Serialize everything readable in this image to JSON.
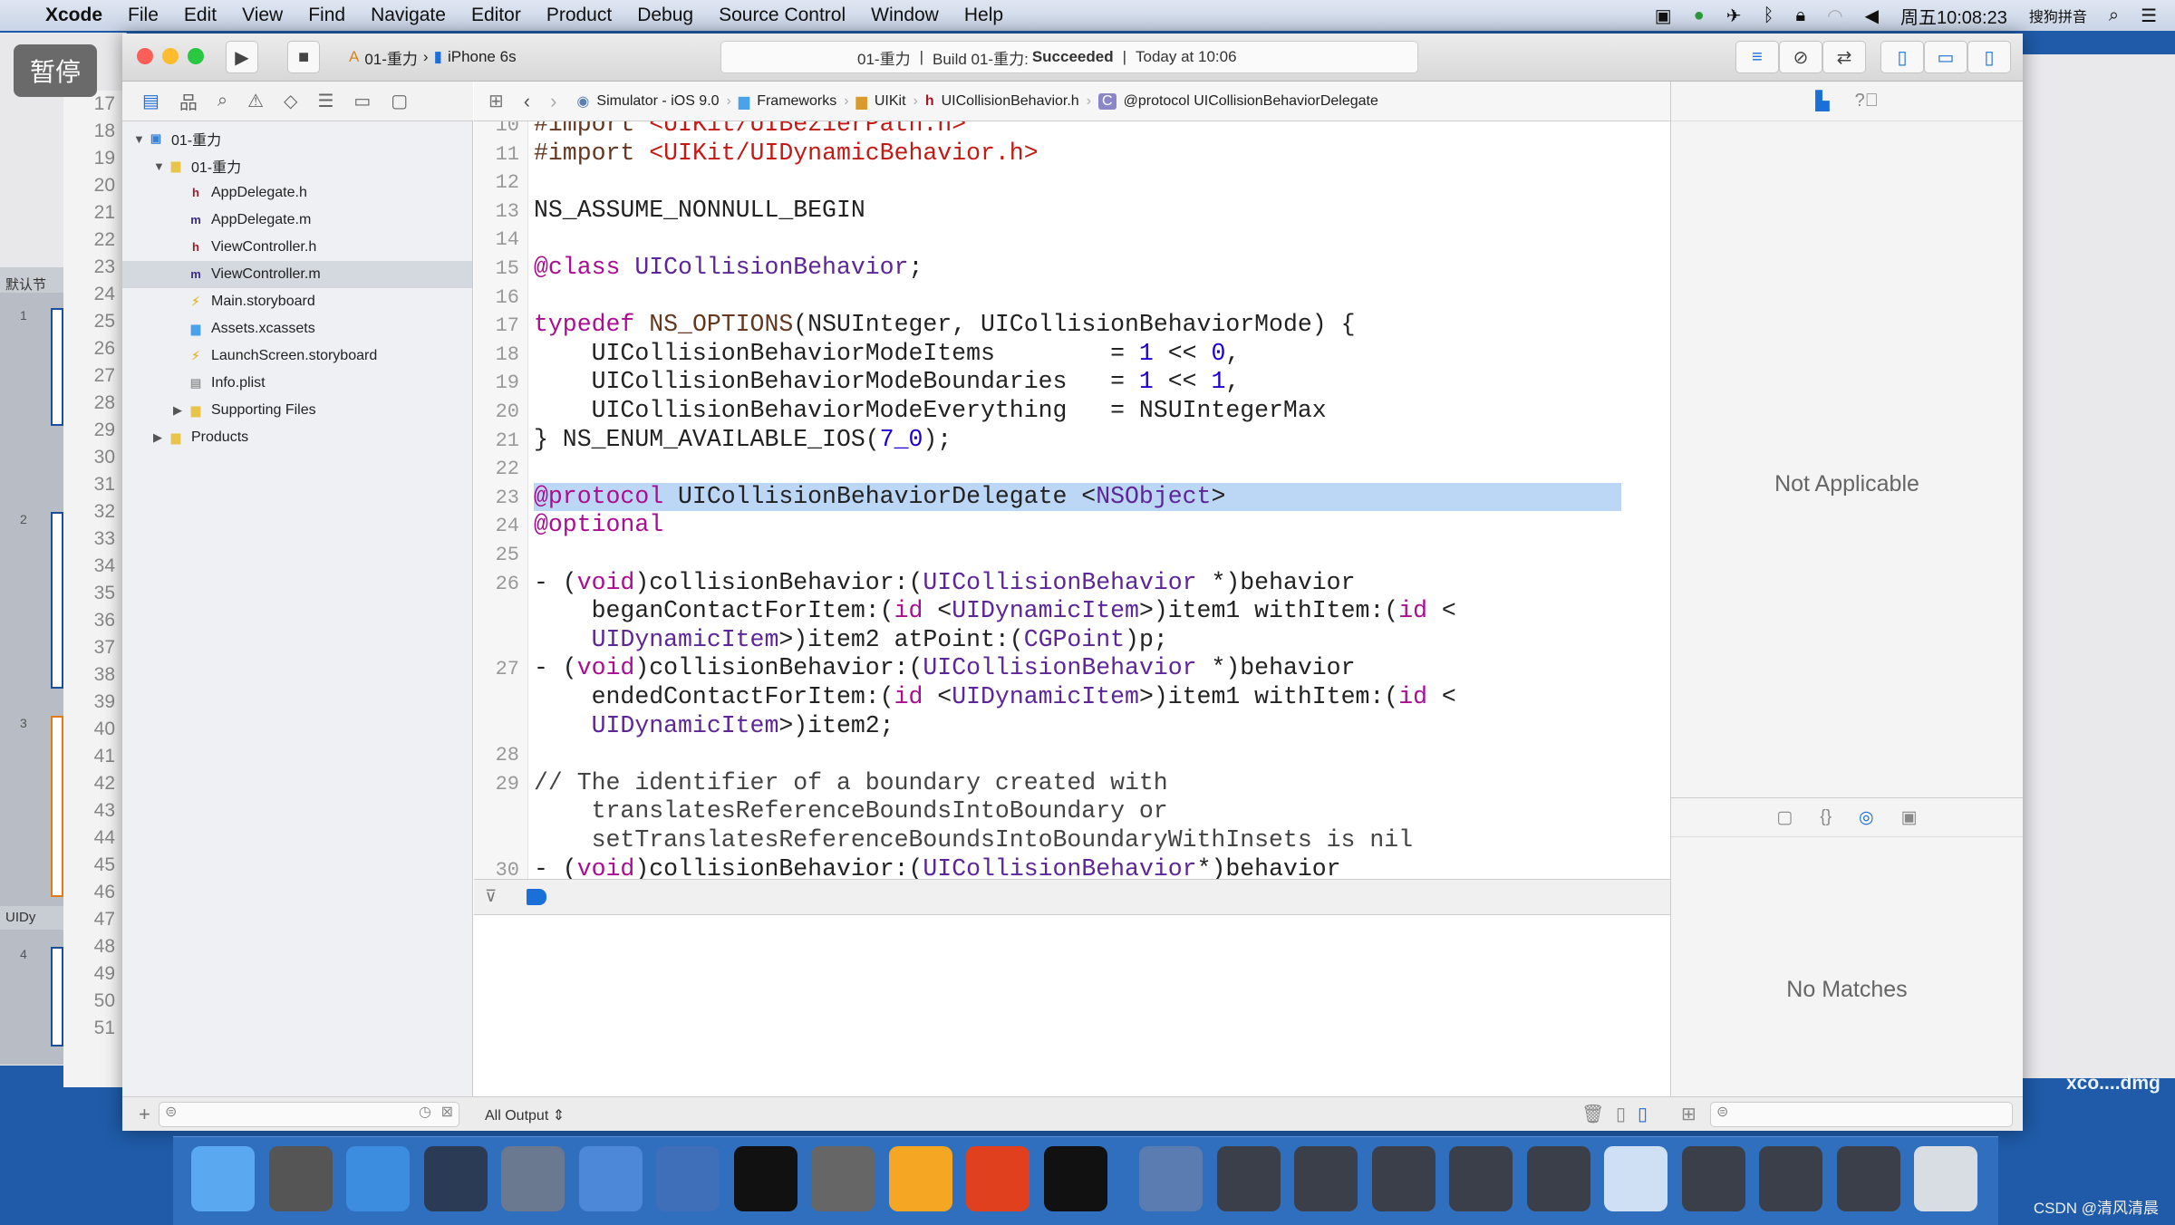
{
  "menubar": {
    "app": "Xcode",
    "items": [
      "File",
      "Edit",
      "View",
      "Find",
      "Navigate",
      "Editor",
      "Product",
      "Debug",
      "Source Control",
      "Window",
      "Help"
    ],
    "clock": "周五10:08:23",
    "input_method": "搜狗拼音"
  },
  "overlay": {
    "pause_label": "暂停"
  },
  "background_window": {
    "section1": "默认节",
    "section2": "UIDy",
    "line_numbers": [
      "17",
      "18",
      "19",
      "20",
      "21",
      "22",
      "23",
      "24",
      "25",
      "26",
      "27",
      "28",
      "29",
      "30",
      "31",
      "32",
      "33",
      "34",
      "35",
      "36",
      "37",
      "38",
      "39",
      "40",
      "41",
      "42",
      "43",
      "44",
      "45",
      "46",
      "47",
      "48",
      "49",
      "50",
      "51"
    ],
    "thumbs": [
      "1",
      "2",
      "3",
      "4"
    ]
  },
  "toolbar": {
    "scheme": "01-重力",
    "device": "iPhone 6s",
    "activity_project": "01-重力",
    "activity_build": "Build 01-重力:",
    "activity_status": "Succeeded",
    "activity_time": "Today at 10:06"
  },
  "jumpbar": [
    "Simulator - iOS 9.0",
    "Frameworks",
    "UIKit",
    "UICollisionBehavior.h",
    "@protocol UICollisionBehaviorDelegate"
  ],
  "navigator": {
    "items": [
      {
        "label": "01-重力",
        "type": "project",
        "depth": 0,
        "expanded": true
      },
      {
        "label": "01-重力",
        "type": "folder",
        "depth": 1,
        "expanded": true
      },
      {
        "label": "AppDelegate.h",
        "type": "h",
        "depth": 2
      },
      {
        "label": "AppDelegate.m",
        "type": "m",
        "depth": 2
      },
      {
        "label": "ViewController.h",
        "type": "h",
        "depth": 2
      },
      {
        "label": "ViewController.m",
        "type": "m",
        "depth": 2,
        "selected": true
      },
      {
        "label": "Main.storyboard",
        "type": "storyboard",
        "depth": 2
      },
      {
        "label": "Assets.xcassets",
        "type": "assets",
        "depth": 2
      },
      {
        "label": "LaunchScreen.storyboard",
        "type": "storyboard",
        "depth": 2
      },
      {
        "label": "Info.plist",
        "type": "plist",
        "depth": 2
      },
      {
        "label": "Supporting Files",
        "type": "folder",
        "depth": 2,
        "expanded": false
      },
      {
        "label": "Products",
        "type": "folder",
        "depth": 1,
        "expanded": false
      }
    ]
  },
  "code": [
    {
      "n": "10",
      "t": [
        [
          "m",
          "#import "
        ],
        [
          "s",
          "<UIKit/UIBezierPath.h>"
        ]
      ]
    },
    {
      "n": "11",
      "t": [
        [
          "m",
          "#import "
        ],
        [
          "s",
          "<UIKit/UIDynamicBehavior.h>"
        ]
      ]
    },
    {
      "n": "12",
      "t": []
    },
    {
      "n": "13",
      "t": [
        [
          "p",
          "NS_ASSUME_NONNULL_BEGIN"
        ]
      ]
    },
    {
      "n": "14",
      "t": []
    },
    {
      "n": "15",
      "t": [
        [
          "k",
          "@class"
        ],
        [
          "p",
          " "
        ],
        [
          "t",
          "UICollisionBehavior"
        ],
        [
          "p",
          ";"
        ]
      ]
    },
    {
      "n": "16",
      "t": []
    },
    {
      "n": "17",
      "t": [
        [
          "k",
          "typedef"
        ],
        [
          "p",
          " "
        ],
        [
          "m",
          "NS_OPTIONS"
        ],
        [
          "p",
          "(NSUInteger, UICollisionBehaviorMode) {"
        ]
      ]
    },
    {
      "n": "18",
      "t": [
        [
          "p",
          "    UICollisionBehaviorModeItems        = "
        ],
        [
          "n",
          "1"
        ],
        [
          "p",
          " << "
        ],
        [
          "n",
          "0"
        ],
        [
          "p",
          ","
        ]
      ]
    },
    {
      "n": "19",
      "t": [
        [
          "p",
          "    UICollisionBehaviorModeBoundaries   = "
        ],
        [
          "n",
          "1"
        ],
        [
          "p",
          " << "
        ],
        [
          "n",
          "1"
        ],
        [
          "p",
          ","
        ]
      ]
    },
    {
      "n": "20",
      "t": [
        [
          "p",
          "    UICollisionBehaviorModeEverything   = NSUIntegerMax"
        ]
      ]
    },
    {
      "n": "21",
      "t": [
        [
          "p",
          "} NS_ENUM_AVAILABLE_IOS("
        ],
        [
          "n",
          "7_0"
        ],
        [
          "p",
          ");"
        ]
      ]
    },
    {
      "n": "22",
      "t": []
    },
    {
      "n": "23",
      "hl": true,
      "t": [
        [
          "k",
          "@protocol"
        ],
        [
          "p",
          " UICollisionBehaviorDelegate <"
        ],
        [
          "t",
          "NSObject"
        ],
        [
          "p",
          ">"
        ]
      ]
    },
    {
      "n": "24",
      "t": [
        [
          "k",
          "@optional"
        ]
      ]
    },
    {
      "n": "25",
      "t": []
    },
    {
      "n": "26",
      "t": [
        [
          "p",
          "- ("
        ],
        [
          "k",
          "void"
        ],
        [
          "p",
          ")collisionBehavior:("
        ],
        [
          "t",
          "UICollisionBehavior"
        ],
        [
          "p",
          " *)behavior"
        ]
      ]
    },
    {
      "n": "",
      "t": [
        [
          "p",
          "    beganContactForItem:("
        ],
        [
          "k",
          "id"
        ],
        [
          "p",
          " <"
        ],
        [
          "t",
          "UIDynamicItem"
        ],
        [
          "p",
          ">)item1 withItem:("
        ],
        [
          "k",
          "id"
        ],
        [
          "p",
          " <"
        ]
      ]
    },
    {
      "n": "",
      "t": [
        [
          "p",
          "    "
        ],
        [
          "t",
          "UIDynamicItem"
        ],
        [
          "p",
          ">)item2 atPoint:("
        ],
        [
          "t",
          "CGPoint"
        ],
        [
          "p",
          ")p;"
        ]
      ]
    },
    {
      "n": "27",
      "t": [
        [
          "p",
          "- ("
        ],
        [
          "k",
          "void"
        ],
        [
          "p",
          ")collisionBehavior:("
        ],
        [
          "t",
          "UICollisionBehavior"
        ],
        [
          "p",
          " *)behavior"
        ]
      ]
    },
    {
      "n": "",
      "t": [
        [
          "p",
          "    endedContactForItem:("
        ],
        [
          "k",
          "id"
        ],
        [
          "p",
          " <"
        ],
        [
          "t",
          "UIDynamicItem"
        ],
        [
          "p",
          ">)item1 withItem:("
        ],
        [
          "k",
          "id"
        ],
        [
          "p",
          " <"
        ]
      ]
    },
    {
      "n": "",
      "t": [
        [
          "p",
          "    "
        ],
        [
          "t",
          "UIDynamicItem"
        ],
        [
          "p",
          ">)item2;"
        ]
      ]
    },
    {
      "n": "28",
      "t": []
    },
    {
      "n": "29",
      "t": [
        [
          "c",
          "// The identifier of a boundary created with"
        ]
      ]
    },
    {
      "n": "",
      "t": [
        [
          "c",
          "    translatesReferenceBoundsIntoBoundary or"
        ]
      ]
    },
    {
      "n": "",
      "t": [
        [
          "c",
          "    setTranslatesReferenceBoundsIntoBoundaryWithInsets is nil"
        ]
      ]
    },
    {
      "n": "30",
      "t": [
        [
          "p",
          "- ("
        ],
        [
          "k",
          "void"
        ],
        [
          "p",
          ")collisionBehavior:("
        ],
        [
          "t",
          "UICollisionBehavior"
        ],
        [
          "p",
          "*)behavior"
        ]
      ]
    }
  ],
  "console": {
    "output_filter": "All Output ⇕"
  },
  "inspector": {
    "top_message": "Not Applicable",
    "bottom_message": "No Matches"
  },
  "dock": {
    "apps": [
      "finder",
      "launchpad",
      "safari",
      "mouse-app",
      "photo-slideshow",
      "xcode",
      "instruments",
      "terminal",
      "system-preferences",
      "sketch",
      "powerpoint-like-p",
      "console",
      "quicktime",
      "screenshot-1",
      "screenshot-2",
      "screenshot-3",
      "screenshot-4",
      "screenshot-5",
      "preview",
      "screenshot-6",
      "screenshot-7",
      "screenshot-8",
      "trash"
    ],
    "download_label": "xco....dmg"
  },
  "watermark": "CSDN @清风清晨",
  "colors": {
    "accent": "#1a6fd8",
    "highlight": "#bcd6f5",
    "keyword": "#aa0d91",
    "type": "#5c2699",
    "number": "#1c00cf",
    "string": "#c41a16"
  }
}
